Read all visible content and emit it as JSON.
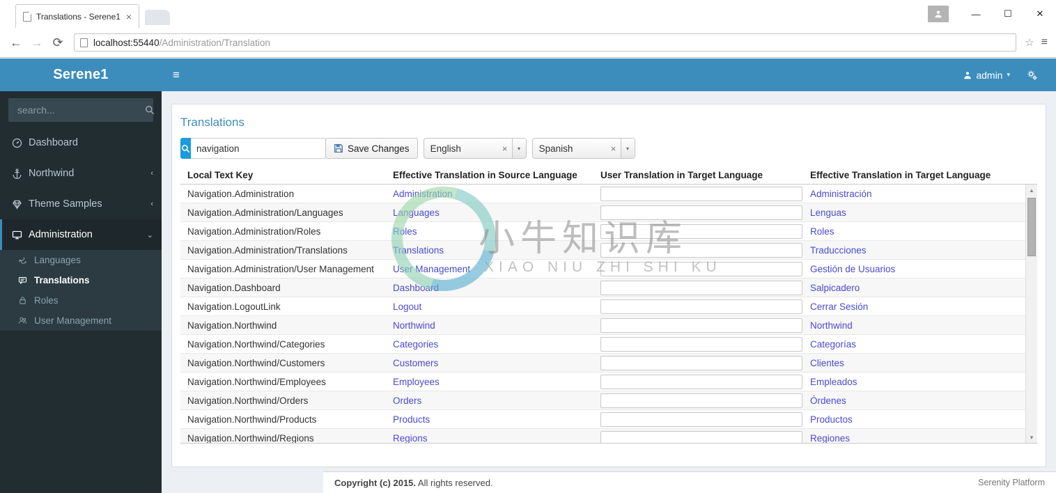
{
  "browser": {
    "tab_title": "Translations - Serene1",
    "tab_close": "×",
    "back_icon": "←",
    "forward_icon": "→",
    "reload_icon": "⟳",
    "url_host": "localhost:55440",
    "url_path": "/Administration/Translation",
    "star_icon": "☆",
    "menu_icon": "≡",
    "minimize": "—",
    "maximize": "☐",
    "close": "✕"
  },
  "sidebar": {
    "brand": "Serene1",
    "search_placeholder": "search...",
    "search_value": "",
    "items": [
      {
        "label": "Dashboard",
        "icon": "dashboard-icon",
        "caret": ""
      },
      {
        "label": "Northwind",
        "icon": "anchor-icon",
        "caret": "‹"
      },
      {
        "label": "Theme Samples",
        "icon": "diamond-icon",
        "caret": "‹"
      },
      {
        "label": "Administration",
        "icon": "desktop-icon",
        "caret": "⌄"
      }
    ],
    "submenu": [
      {
        "label": "Languages",
        "icon": "comments-icon"
      },
      {
        "label": "Translations",
        "icon": "comment-icon"
      },
      {
        "label": "Roles",
        "icon": "lock-icon"
      },
      {
        "label": "User Management",
        "icon": "users-icon"
      }
    ]
  },
  "navbar": {
    "bars_icon": "≡",
    "user_label": "admin",
    "user_caret": "▾",
    "gear_icon": "gears-icon"
  },
  "page": {
    "title": "Translations"
  },
  "toolbar": {
    "search_placeholder": "",
    "search_value": "navigation",
    "search_icon": "🔍",
    "save_label": "Save Changes",
    "save_icon": "floppy-icon",
    "source_language": "English",
    "target_language": "Spanish",
    "clear_icon": "×",
    "arrow_icon": "▾"
  },
  "grid": {
    "columns": [
      "Local Text Key",
      "Effective Translation in Source Language",
      "User Translation in Target Language",
      "Effective Translation in Target Language"
    ],
    "rows": [
      {
        "key": "Navigation.Administration",
        "source": "Administration",
        "user": "",
        "target": "Administración"
      },
      {
        "key": "Navigation.Administration/Languages",
        "source": "Languages",
        "user": "",
        "target": "Lenguas"
      },
      {
        "key": "Navigation.Administration/Roles",
        "source": "Roles",
        "user": "",
        "target": "Roles"
      },
      {
        "key": "Navigation.Administration/Translations",
        "source": "Translations",
        "user": "",
        "target": "Traducciones"
      },
      {
        "key": "Navigation.Administration/User Management",
        "source": "User Management",
        "user": "",
        "target": "Gestión de Usuarios"
      },
      {
        "key": "Navigation.Dashboard",
        "source": "Dashboard",
        "user": "",
        "target": "Salpicadero"
      },
      {
        "key": "Navigation.LogoutLink",
        "source": "Logout",
        "user": "",
        "target": "Cerrar Sesión"
      },
      {
        "key": "Navigation.Northwind",
        "source": "Northwind",
        "user": "",
        "target": "Northwind"
      },
      {
        "key": "Navigation.Northwind/Categories",
        "source": "Categories",
        "user": "",
        "target": "Categorías"
      },
      {
        "key": "Navigation.Northwind/Customers",
        "source": "Customers",
        "user": "",
        "target": "Clientes"
      },
      {
        "key": "Navigation.Northwind/Employees",
        "source": "Employees",
        "user": "",
        "target": "Empleados"
      },
      {
        "key": "Navigation.Northwind/Orders",
        "source": "Orders",
        "user": "",
        "target": "Órdenes"
      },
      {
        "key": "Navigation.Northwind/Products",
        "source": "Products",
        "user": "",
        "target": "Productos"
      },
      {
        "key": "Navigation.Northwind/Regions",
        "source": "Regions",
        "user": "",
        "target": "Regiones"
      },
      {
        "key": "",
        "source": "",
        "user": "",
        "target": ""
      }
    ],
    "scroll_up": "▲",
    "scroll_down": "▼"
  },
  "watermark": {
    "cn": "小牛知识库",
    "pinyin": "XIAO NIU ZHI SHI KU"
  },
  "footer": {
    "copyright_bold": "Copyright (c) 2015.",
    "copyright_rest": " All rights reserved.",
    "right": "Serenity Platform"
  },
  "colors": {
    "brand_blue": "#3c8dbc",
    "sidebar_dark": "#222d32",
    "sidebar_active": "#1e282c",
    "submenu_bg": "#2c3b41",
    "link_blue": "#4a4ad1",
    "title_blue": "#3c8dbc",
    "body_bg": "#ecf0f5",
    "search_btn": "#1a9bde"
  }
}
